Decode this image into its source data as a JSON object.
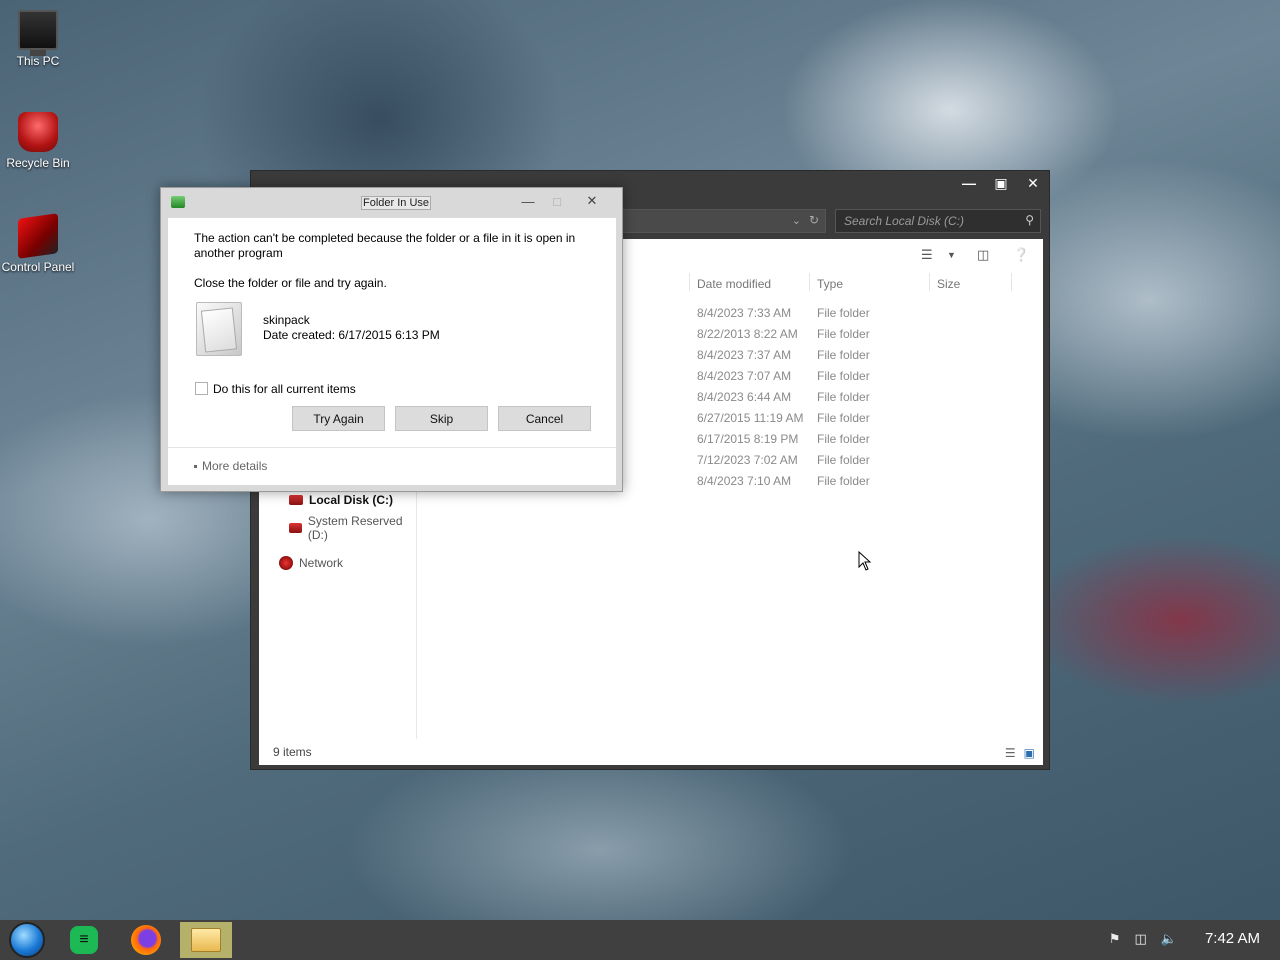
{
  "desktop": {
    "icons": [
      {
        "label": "This PC"
      },
      {
        "label": "Recycle Bin"
      },
      {
        "label": "Control Panel"
      }
    ]
  },
  "explorer": {
    "search_placeholder": "Search Local Disk (C:)",
    "columns": {
      "date": "Date modified",
      "type": "Type",
      "size": "Size"
    },
    "rows": [
      {
        "date": "8/4/2023 7:33 AM",
        "type": "File folder"
      },
      {
        "date": "8/22/2013 8:22 AM",
        "type": "File folder"
      },
      {
        "date": "8/4/2023 7:37 AM",
        "type": "File folder"
      },
      {
        "date": "8/4/2023 7:07 AM",
        "type": "File folder"
      },
      {
        "date": "8/4/2023 6:44 AM",
        "type": "File folder"
      },
      {
        "date": "6/27/2015 11:19 AM",
        "type": "File folder"
      },
      {
        "date": "6/17/2015 8:19 PM",
        "type": "File folder"
      },
      {
        "date": "7/12/2023 7:02 AM",
        "type": "File folder"
      },
      {
        "date": "8/4/2023 7:10 AM",
        "type": "File folder"
      }
    ],
    "nav": {
      "local_disk": "Local Disk (C:)",
      "system_reserved": "System Reserved (D:)",
      "network": "Network"
    },
    "status": "9 items"
  },
  "dialog": {
    "title": "Folder In Use",
    "message": "The action can't be completed because the folder or a file in it is open in another program",
    "instruction": "Close the folder or file and try again.",
    "file_name": "skinpack",
    "file_date": "Date created: 6/17/2015 6:13 PM",
    "checkbox_label": "Do this for all current items",
    "buttons": {
      "try_again": "Try Again",
      "skip": "Skip",
      "cancel": "Cancel"
    },
    "more_details": "More details"
  },
  "taskbar": {
    "clock": "7:42 AM"
  }
}
